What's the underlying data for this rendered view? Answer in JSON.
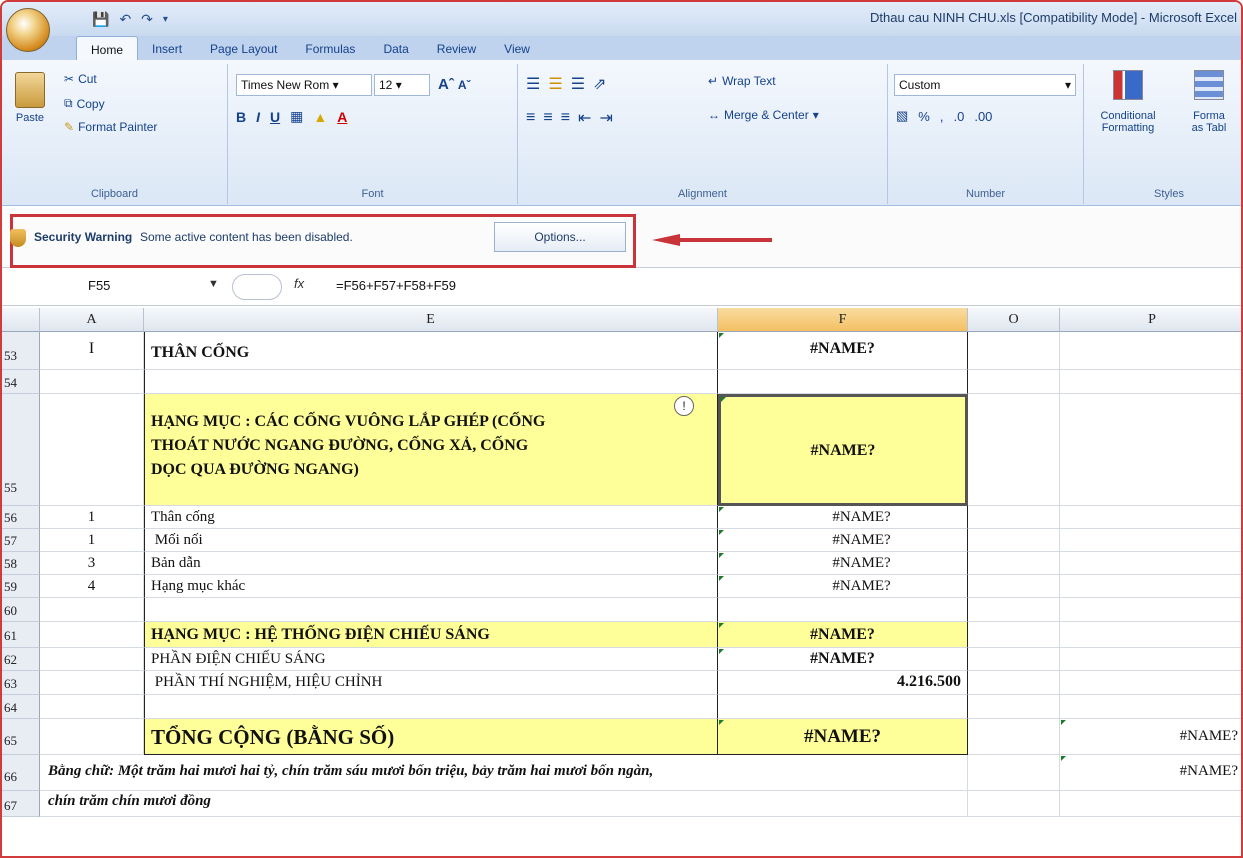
{
  "titlebar": {
    "title": "Dthau cau NINH CHU.xls  [Compatibility Mode] - Microsoft Excel"
  },
  "tabs": [
    "Home",
    "Insert",
    "Page Layout",
    "Formulas",
    "Data",
    "Review",
    "View"
  ],
  "ribbon": {
    "clipboard": {
      "paste": "Paste",
      "cut": "Cut",
      "copy": "Copy",
      "format_painter": "Format Painter",
      "label": "Clipboard"
    },
    "font": {
      "name": "Times New Rom",
      "size": "12",
      "label": "Font"
    },
    "alignment": {
      "wrap": "Wrap Text",
      "merge": "Merge & Center",
      "label": "Alignment"
    },
    "number": {
      "format": "Custom",
      "label": "Number"
    },
    "styles": {
      "cond": "Conditional",
      "cond2": "Formatting",
      "format": "Forma",
      "format2": "as Tabl",
      "label": "Styles"
    }
  },
  "security": {
    "title": "Security Warning",
    "message": "Some active content has been disabled.",
    "options": "Options..."
  },
  "formula_bar": {
    "cell": "F55",
    "fx": "fx",
    "formula": "=F56+F57+F58+F59"
  },
  "columns": [
    "A",
    "E",
    "F",
    "O",
    "P"
  ],
  "rows": {
    "r53": {
      "num": "53",
      "a": "I",
      "e": "THÂN CỐNG",
      "f": "#NAME?"
    },
    "r54": {
      "num": "54"
    },
    "r55": {
      "num": "55",
      "e1": "HẠNG MỤC : CÁC CỐNG VUÔNG LẮP GHÉP (CỐNG",
      "e2": "THOÁT NƯỚC NGANG ĐƯỜNG, CỐNG XẢ, CỐNG",
      "e3": "DỌC QUA ĐƯỜNG NGANG)",
      "f": "#NAME?"
    },
    "r56": {
      "num": "56",
      "a": "1",
      "e": "Thân cống",
      "f": "#NAME?"
    },
    "r57": {
      "num": "57",
      "a": "1",
      "e": " Mối nối",
      "f": "#NAME?"
    },
    "r58": {
      "num": "58",
      "a": "3",
      "e": "Bản dẫn",
      "f": "#NAME?"
    },
    "r59": {
      "num": "59",
      "a": "4",
      "e": "Hạng mục khác",
      "f": "#NAME?"
    },
    "r60": {
      "num": "60"
    },
    "r61": {
      "num": "61",
      "e": "HẠNG MỤC : HỆ THỐNG ĐIỆN CHIẾU SÁNG",
      "f": "#NAME?"
    },
    "r62": {
      "num": "62",
      "e": "PHẦN ĐIỆN CHIẾU SÁNG",
      "f": "#NAME?"
    },
    "r63": {
      "num": "63",
      "e": " PHẦN THÍ NGHIỆM, HIỆU CHỈNH",
      "f": "4.216.500"
    },
    "r64": {
      "num": "64"
    },
    "r65": {
      "num": "65",
      "e": "TỔNG CỘNG (BẰNG SỐ)",
      "f": "#NAME?",
      "p": "#NAME?"
    },
    "r66": {
      "num": "66",
      "text": "Bằng chữ: Một trăm hai mươi hai tỷ, chín trăm sáu mươi bốn triệu, bảy trăm hai mươi bốn ngàn,",
      "p": "#NAME?"
    },
    "r67": {
      "num": "67",
      "text": "chín trăm chín mươi đồng"
    }
  }
}
